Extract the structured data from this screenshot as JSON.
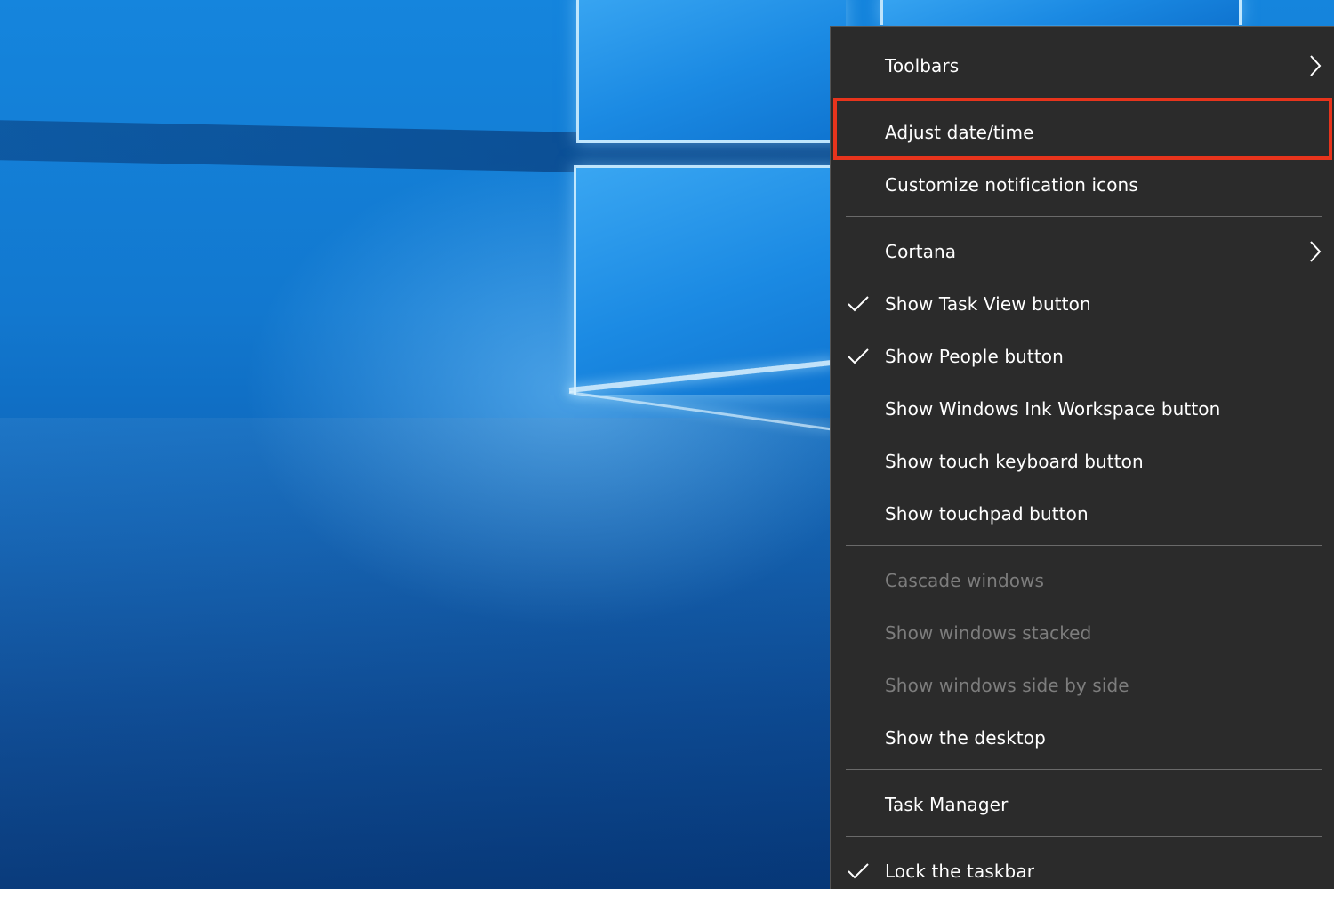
{
  "context_menu": {
    "items": [
      {
        "label": "Toolbars",
        "checked": false,
        "submenu": true,
        "enabled": true
      },
      {
        "label": "Adjust date/time",
        "checked": false,
        "submenu": false,
        "enabled": true,
        "highlighted": true
      },
      {
        "label": "Customize notification icons",
        "checked": false,
        "submenu": false,
        "enabled": true
      },
      {
        "label": "Cortana",
        "checked": false,
        "submenu": true,
        "enabled": true
      },
      {
        "label": "Show Task View button",
        "checked": true,
        "submenu": false,
        "enabled": true
      },
      {
        "label": "Show People button",
        "checked": true,
        "submenu": false,
        "enabled": true
      },
      {
        "label": "Show Windows Ink Workspace button",
        "checked": false,
        "submenu": false,
        "enabled": true
      },
      {
        "label": "Show touch keyboard button",
        "checked": false,
        "submenu": false,
        "enabled": true
      },
      {
        "label": "Show touchpad button",
        "checked": false,
        "submenu": false,
        "enabled": true
      },
      {
        "label": "Cascade windows",
        "checked": false,
        "submenu": false,
        "enabled": false
      },
      {
        "label": "Show windows stacked",
        "checked": false,
        "submenu": false,
        "enabled": false
      },
      {
        "label": "Show windows side by side",
        "checked": false,
        "submenu": false,
        "enabled": false
      },
      {
        "label": "Show the desktop",
        "checked": false,
        "submenu": false,
        "enabled": true
      },
      {
        "label": "Task Manager",
        "checked": false,
        "submenu": false,
        "enabled": true
      },
      {
        "label": "Lock the taskbar",
        "checked": true,
        "submenu": false,
        "enabled": true
      }
    ]
  },
  "colors": {
    "menu_background": "#2b2b2b",
    "menu_text": "#ffffff",
    "disabled_text": "#7d7d7d",
    "highlight_outline": "#e8341c"
  },
  "icons": {
    "check": "check-icon",
    "submenu": "chevron-right-icon"
  }
}
